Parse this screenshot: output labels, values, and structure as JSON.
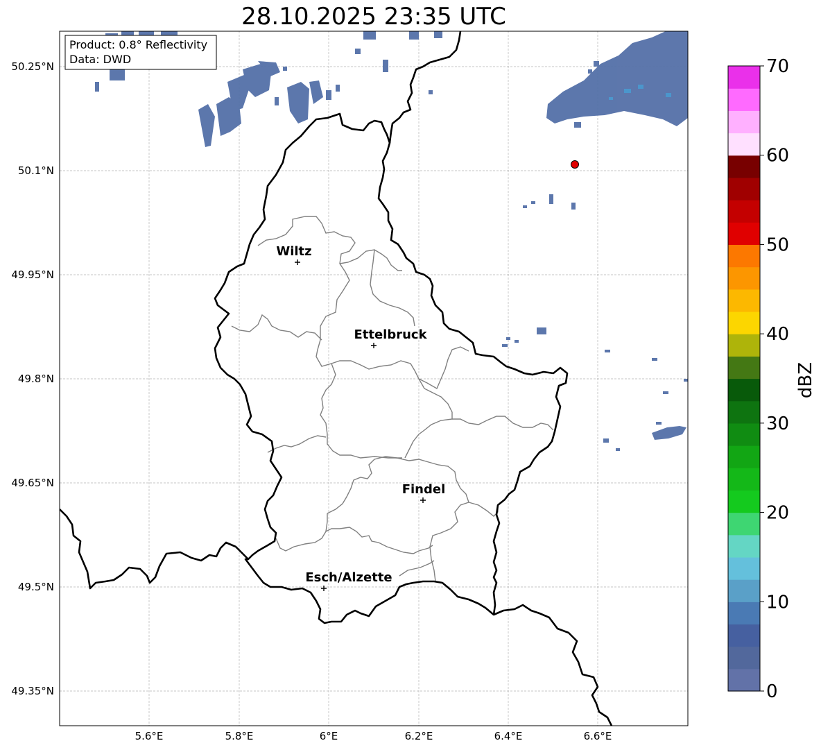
{
  "title": "28.10.2025 23:35 UTC",
  "info_box": {
    "product_line": "Product: 0.8° Reflectivity",
    "data_line": "Data: DWD"
  },
  "map": {
    "lon_range": [
      5.4,
      6.8
    ],
    "lat_range": [
      49.3,
      50.3
    ],
    "lon_ticks": [
      "5.6°E",
      "5.8°E",
      "6°E",
      "6.2°E",
      "6.4°E",
      "6.6°E"
    ],
    "lat_ticks": [
      "50.25°N",
      "50.1°N",
      "49.95°N",
      "49.8°N",
      "49.65°N",
      "49.5°N",
      "49.35°N"
    ],
    "grid": true,
    "cities": [
      {
        "name": "Wiltz",
        "lon": 5.93,
        "lat": 49.966
      },
      {
        "name": "Ettelbruck",
        "lon": 6.1,
        "lat": 49.847
      },
      {
        "name": "Findel",
        "lon": 6.21,
        "lat": 49.624
      },
      {
        "name": "Esch/Alzette",
        "lon": 5.99,
        "lat": 49.497
      }
    ],
    "radar_site": {
      "lon": 6.548,
      "lat": 50.11,
      "color": "#e00000"
    },
    "border_color": "#000000",
    "canton_color": "#808080",
    "echo_color": "#5470a8"
  },
  "colorbar": {
    "label": "dBZ",
    "tick_labels": [
      "0",
      "10",
      "20",
      "30",
      "40",
      "50",
      "60",
      "70"
    ],
    "range": [
      0,
      70
    ],
    "colors": [
      "#6272a8",
      "#52689c",
      "#4660a0",
      "#4a7ab4",
      "#5aa0c8",
      "#64c0dc",
      "#64d6c4",
      "#3ed672",
      "#14ca1e",
      "#14b818",
      "#12a614",
      "#108c12",
      "#0e7410",
      "#085a0a",
      "#447814",
      "#aeb40a",
      "#fcd600",
      "#fcb800",
      "#fc9600",
      "#fc7800",
      "#e00000",
      "#c40000",
      "#a00000",
      "#780000",
      "#ffe0ff",
      "#ffb0ff",
      "#ff6aff",
      "#ea30ea"
    ]
  }
}
